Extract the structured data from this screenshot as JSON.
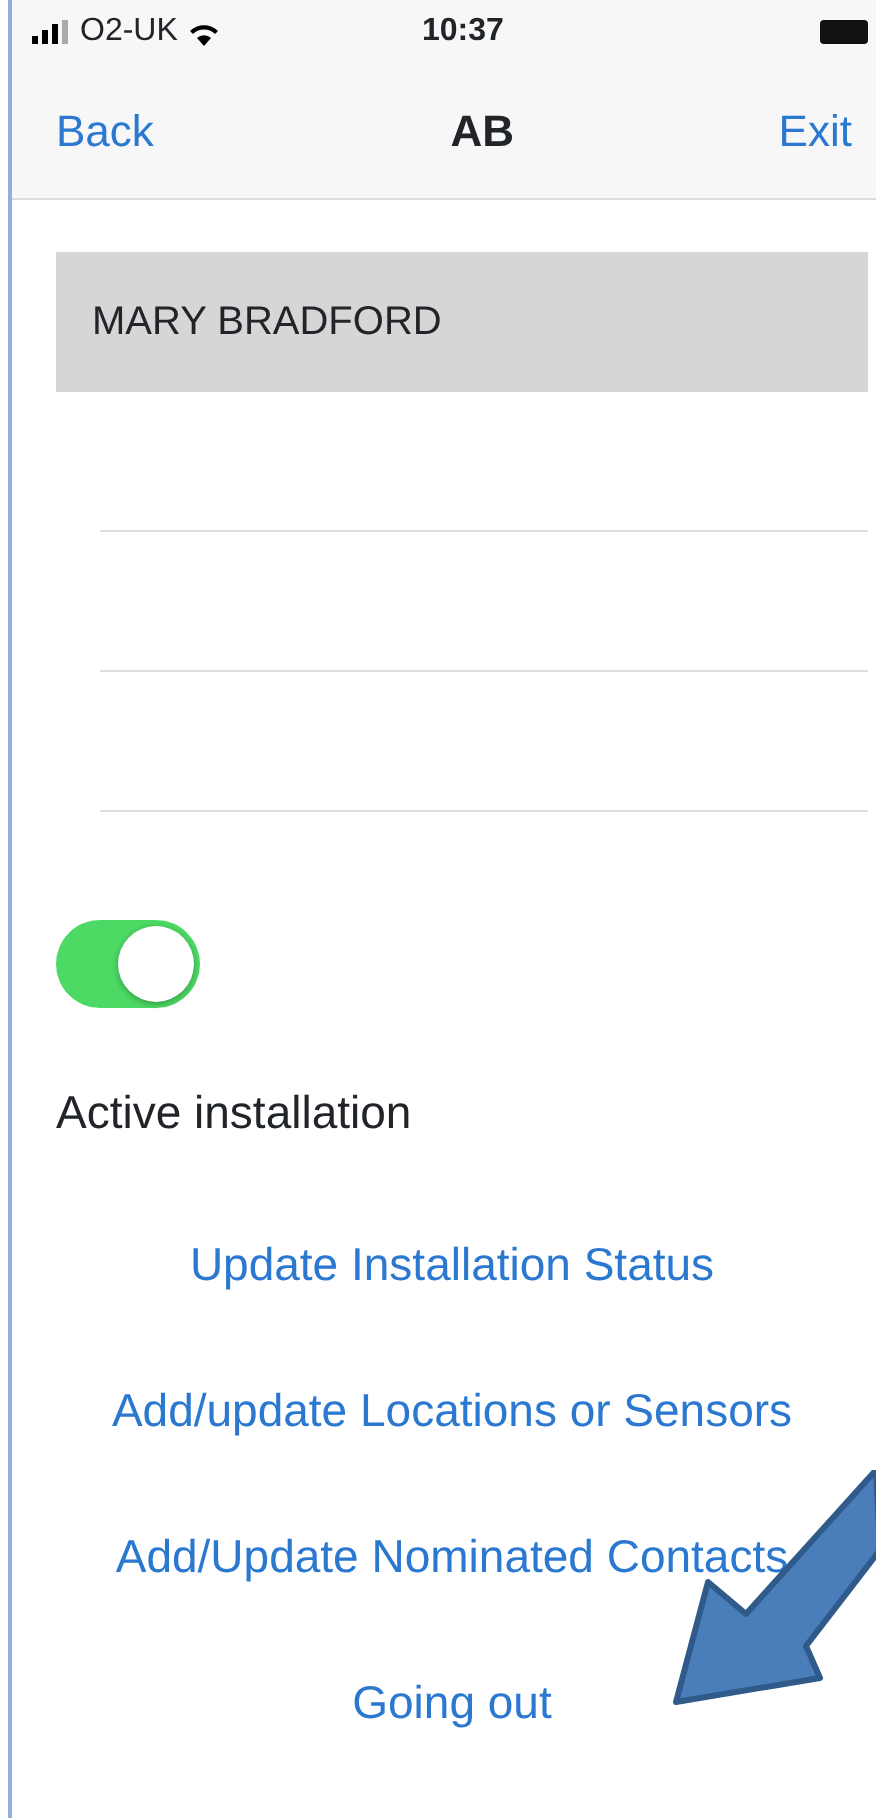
{
  "status_bar": {
    "carrier": "O2-UK",
    "time": "10:37"
  },
  "nav": {
    "back": "Back",
    "title": "AB",
    "exit": "Exit"
  },
  "name_row": {
    "text": "MARY BRADFORD"
  },
  "active_toggle": {
    "on": true,
    "label": "Active installation"
  },
  "links": [
    {
      "label": "Update Installation Status"
    },
    {
      "label": "Add/update Locations or Sensors"
    },
    {
      "label": "Add/Update Nominated Contacts"
    },
    {
      "label": "Going out"
    }
  ]
}
